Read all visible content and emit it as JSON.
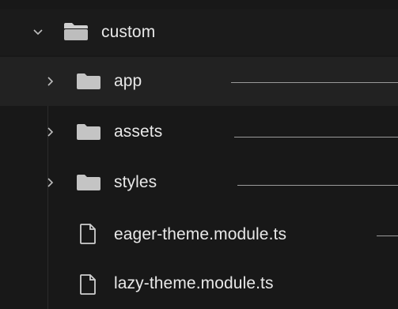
{
  "tree": {
    "root": {
      "label": "custom",
      "icon": "folder-open-icon",
      "expanded": true
    },
    "items": [
      {
        "label": "app",
        "type": "folder",
        "icon": "folder-icon",
        "expanded": false,
        "selected": true
      },
      {
        "label": "assets",
        "type": "folder",
        "icon": "folder-icon",
        "expanded": false,
        "selected": false
      },
      {
        "label": "styles",
        "type": "folder",
        "icon": "folder-icon",
        "expanded": false,
        "selected": false
      },
      {
        "label": "eager-theme.module.ts",
        "type": "file",
        "icon": "file-icon"
      },
      {
        "label": "lazy-theme.module.ts",
        "type": "file",
        "icon": "file-icon"
      }
    ]
  },
  "colors": {
    "background": "#181818",
    "selected_row": "#222222",
    "text": "#e8e8e8",
    "icon": "#c8c8c8"
  }
}
